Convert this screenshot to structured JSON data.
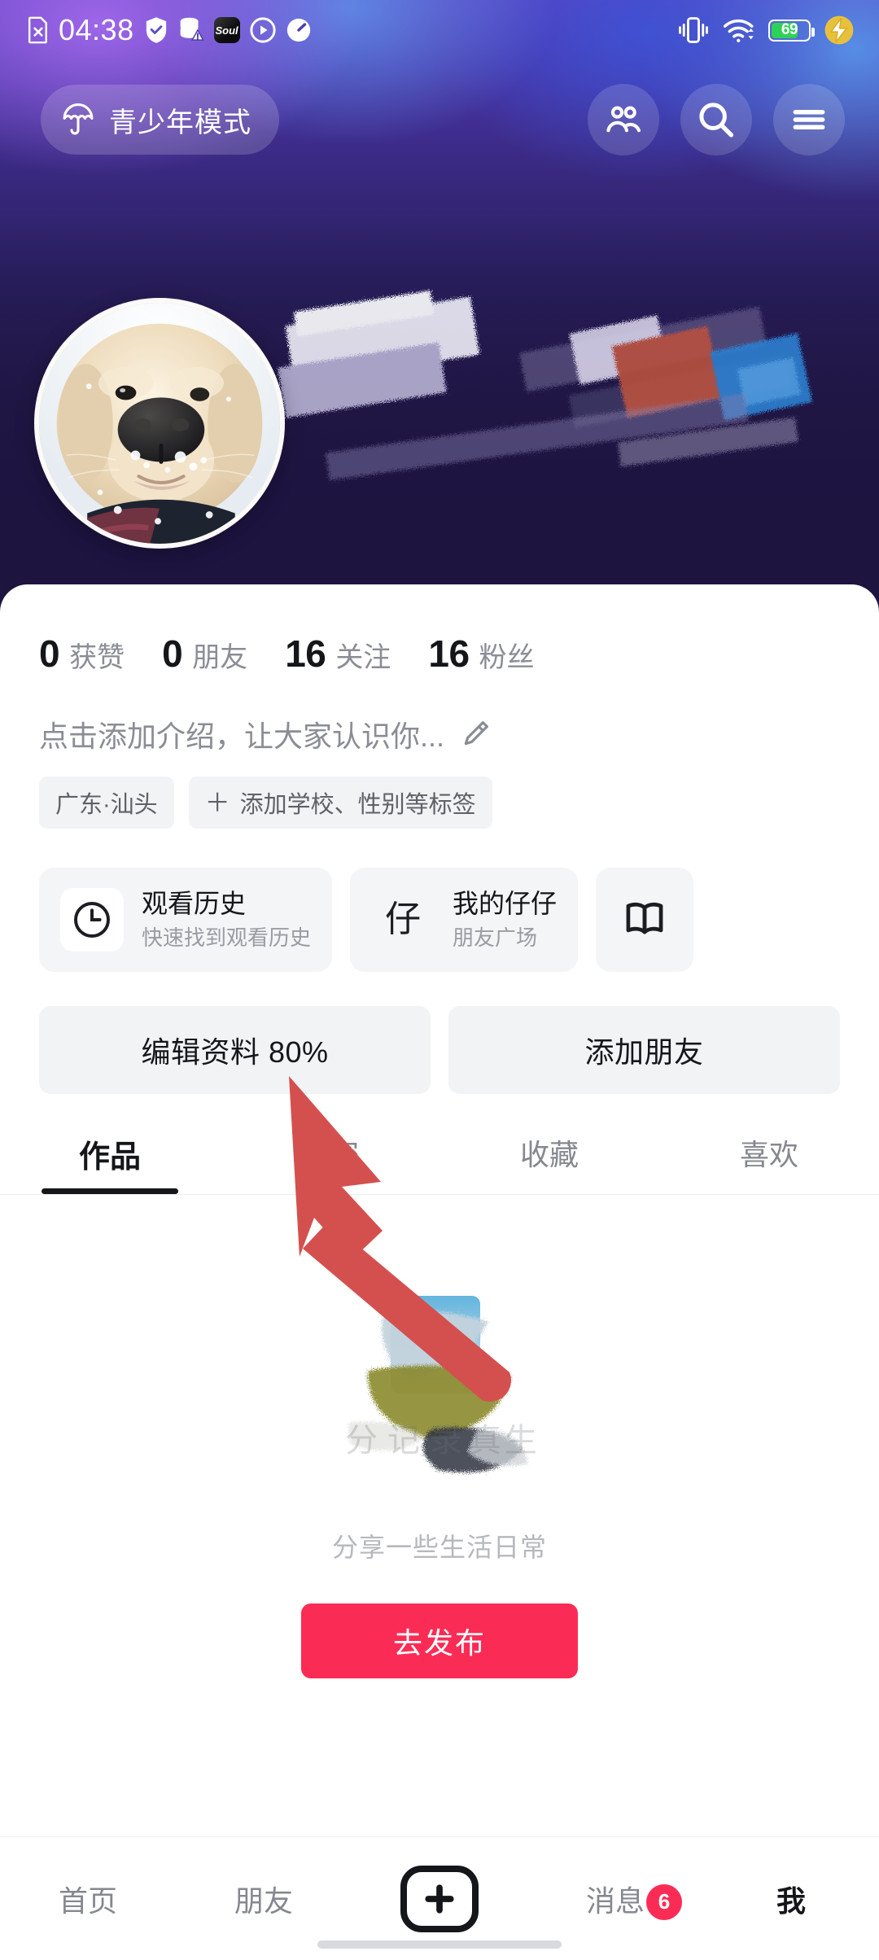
{
  "status_bar": {
    "time": "04:38",
    "left_icons": [
      "no-sim-icon",
      "shield-check-icon",
      "database-warning-icon",
      "soul-app-icon",
      "play-circle-icon",
      "speedometer-icon"
    ],
    "soul_label": "Soul",
    "right_icons": [
      "vibrate-icon",
      "wifi-icon",
      "battery-icon",
      "charging-bolt-icon"
    ],
    "battery_percent": "69"
  },
  "header": {
    "teen_mode_label": "青少年模式",
    "teen_mode_icon": "umbrella-icon",
    "icons": [
      "friends-icon",
      "search-icon",
      "menu-icon"
    ]
  },
  "profile": {
    "avatar_alt": "golden-retriever-puppy-avatar",
    "stats": [
      {
        "value": "0",
        "label": "获赞"
      },
      {
        "value": "0",
        "label": "朋友"
      },
      {
        "value": "16",
        "label": "关注"
      },
      {
        "value": "16",
        "label": "粉丝"
      }
    ],
    "bio_placeholder": "点击添加介绍，让大家认识你...",
    "bio_edit_icon": "pencil-icon",
    "tags": [
      {
        "label": "广东·汕头",
        "has_plus": false
      },
      {
        "label": "添加学校、性别等标签",
        "has_plus": true,
        "plus": "＋"
      }
    ]
  },
  "entry_cards": [
    {
      "icon": "clock-icon",
      "title": "观看历史",
      "subtitle": "快速找到观看历史"
    },
    {
      "icon": "zai-character-icon",
      "icon_char": "仔",
      "title": "我的仔仔",
      "subtitle": "朋友广场"
    },
    {
      "icon": "book-icon",
      "title": "",
      "subtitle": ""
    }
  ],
  "actions": [
    {
      "label": "编辑资料 80%",
      "name": "edit-profile-button"
    },
    {
      "label": "添加朋友",
      "name": "add-friend-button"
    }
  ],
  "tabs": [
    {
      "label": "作品",
      "active": true
    },
    {
      "label": "私密",
      "active": false
    },
    {
      "label": "收藏",
      "active": false
    },
    {
      "label": "喜欢",
      "active": false
    }
  ],
  "empty_state": {
    "caption": "分享一些生活日常",
    "publish_label": "去发布"
  },
  "bottom_nav": [
    {
      "label": "首页",
      "active": false,
      "badge": ""
    },
    {
      "label": "朋友",
      "active": false,
      "badge": ""
    },
    {
      "label": "",
      "active": false,
      "badge": "",
      "icon": "plus-icon"
    },
    {
      "label": "消息",
      "active": false,
      "badge": "6"
    },
    {
      "label": "我",
      "active": true,
      "badge": ""
    }
  ],
  "annotation": {
    "type": "pointer-arrow",
    "color": "#d9534f",
    "points_at": "编辑资料 80%"
  },
  "colors": {
    "accent_red": "#fa2c55",
    "banner_deep": "#1d1440",
    "text_primary": "#15161a",
    "text_muted": "#8b8d95",
    "chip_bg": "#f2f3f5",
    "battery_green": "#2ed158"
  }
}
